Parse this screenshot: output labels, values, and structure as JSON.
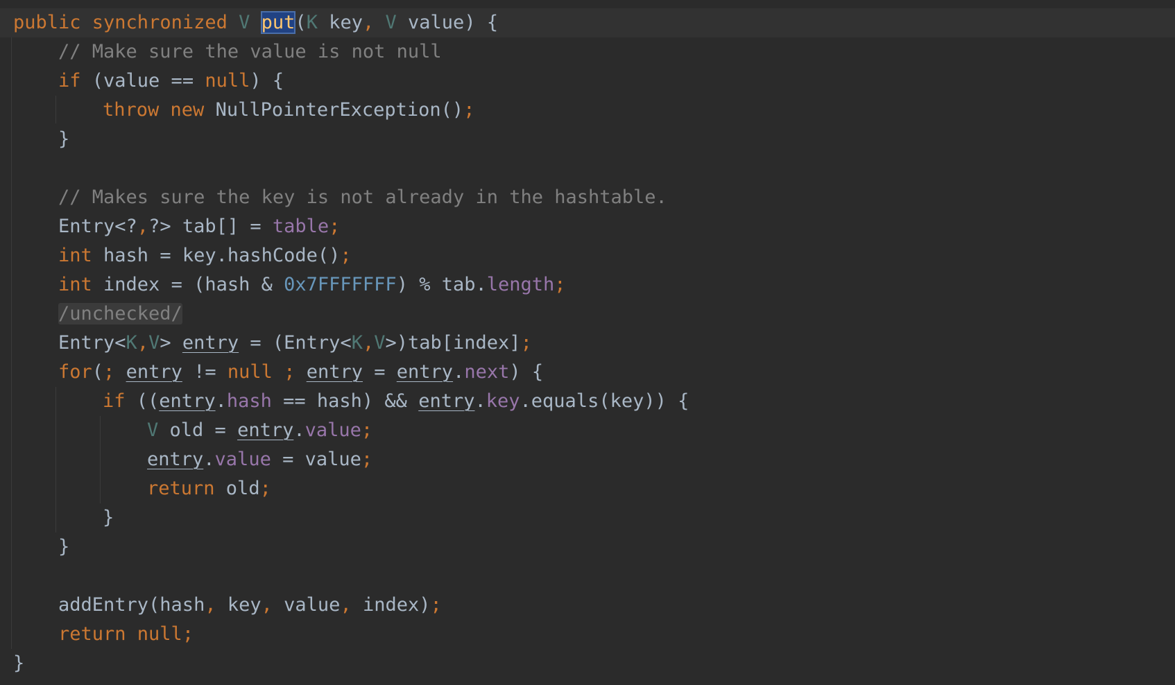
{
  "editor": {
    "colors": {
      "background": "#2b2b2b",
      "keyword": "#cc7832",
      "type_param": "#507874",
      "comment": "#808080",
      "field": "#9876aa",
      "number": "#6897bb",
      "plain": "#a9b7c6",
      "selection": "#214283"
    },
    "l1": {
      "kw1": "public synchronized ",
      "tp1": "V",
      "sp1": " ",
      "method": "put",
      "p1": "(",
      "tp2": "K",
      "p2": " key",
      "c1": ",",
      "sp2": " ",
      "tp3": "V",
      "p3": " value) {"
    },
    "l2": {
      "comment": "// Make sure the value is not null"
    },
    "l3": {
      "kw": "if",
      "p1": " (value == ",
      "kw2": "null",
      "p2": ") {"
    },
    "l4": {
      "kw": "throw new",
      "p1": " NullPointerException()",
      "semi": ";"
    },
    "l5": {
      "p1": "}"
    },
    "l7": {
      "comment": "// Makes sure the key is not already in the hashtable."
    },
    "l8": {
      "p1": "Entry<?",
      "c1": ",",
      "p2": "?> tab[] = ",
      "f1": "table",
      "semi": ";"
    },
    "l9": {
      "kw": "int",
      "p1": " hash = key.hashCode()",
      "semi": ";"
    },
    "l10": {
      "kw": "int",
      "p1": " index = (hash & ",
      "num": "0x7FFFFFFF",
      "p2": ") % tab.",
      "f1": "length",
      "semi": ";"
    },
    "l11": {
      "hint": "/unchecked/"
    },
    "l12": {
      "p1": "Entry<",
      "tp1": "K",
      "c1": ",",
      "tp2": "V",
      "p2": "> ",
      "u1": "entry",
      "p3": " = (Entry<",
      "tp3": "K",
      "c2": ",",
      "tp4": "V",
      "p4": ">)tab[index]",
      "semi": ";"
    },
    "l13": {
      "kw": "for",
      "p1": "(",
      "semi1": ";",
      "sp1": " ",
      "u1": "entry",
      "p2": " != ",
      "kw2": "null",
      "sp2": " ",
      "semi2": ";",
      "sp3": " ",
      "u2": "entry",
      "p3": " = ",
      "u3": "entry",
      "p4": ".",
      "f1": "next",
      "p5": ") {"
    },
    "l14": {
      "kw": "if",
      "p1": " ((",
      "u1": "entry",
      "p2": ".",
      "f1": "hash",
      "p3": " == hash) && ",
      "u2": "entry",
      "p4": ".",
      "f2": "key",
      "p5": ".equals(key)) {"
    },
    "l15": {
      "tp": "V",
      "p1": " old = ",
      "u1": "entry",
      "p2": ".",
      "f1": "value",
      "semi": ";"
    },
    "l16": {
      "u1": "entry",
      "p1": ".",
      "f1": "value",
      "p2": " = value",
      "semi": ";"
    },
    "l17": {
      "kw": "return",
      "p1": " old",
      "semi": ";"
    },
    "l18": {
      "p1": "}"
    },
    "l19": {
      "p1": "}"
    },
    "l21": {
      "p1": "addEntry(hash",
      "c1": ",",
      "p2": " key",
      "c2": ",",
      "p3": " value",
      "c3": ",",
      "p4": " index)",
      "semi": ";"
    },
    "l22": {
      "kw": "return null",
      "semi": ";"
    },
    "l23": {
      "p1": "}"
    }
  }
}
